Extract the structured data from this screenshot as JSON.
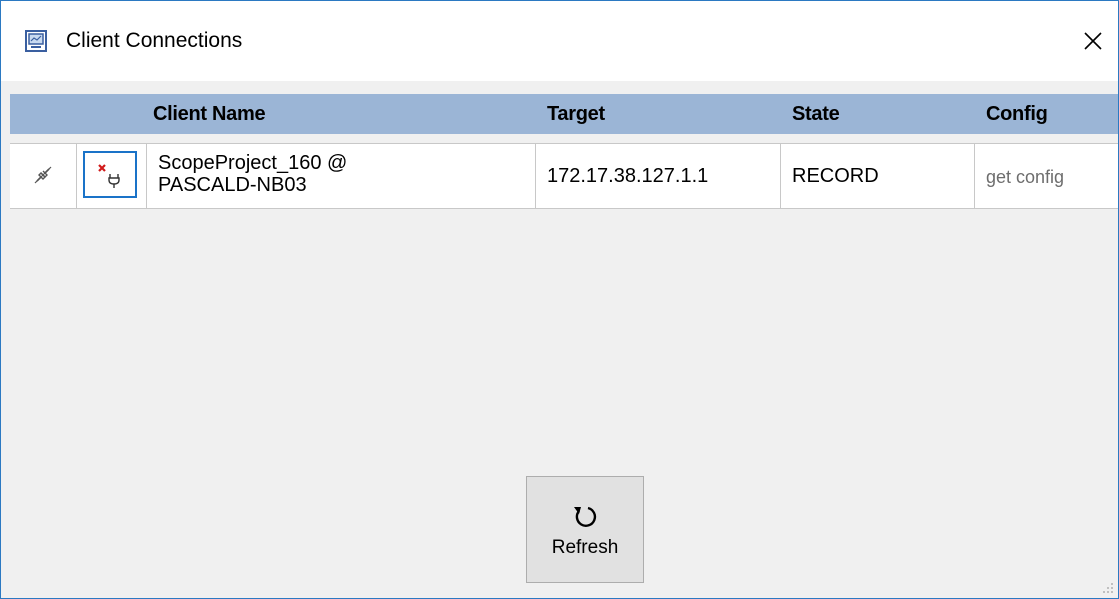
{
  "window": {
    "title": "Client Connections",
    "app_icon": "monitor-icon",
    "close_icon": "close-icon"
  },
  "grid": {
    "columns": [
      "Client Name",
      "Target",
      "State",
      "Config"
    ],
    "rows": [
      {
        "connection_icon": "disconnected-plug-icon",
        "disconnect_icon": "disconnect-plug-x-icon",
        "client_name_line1": "ScopeProject_160 @",
        "client_name_line2": "PASCALD-NB03",
        "target": "172.17.38.127.1.1",
        "state": "RECORD",
        "config": "get config"
      }
    ]
  },
  "refresh": {
    "label": "Refresh",
    "icon": "refresh-icon"
  },
  "colors": {
    "header_bg": "#9bb5d6",
    "window_border": "#2b79c2",
    "selected_border": "#1a73c8",
    "disconnect_x": "#d11a1a"
  }
}
